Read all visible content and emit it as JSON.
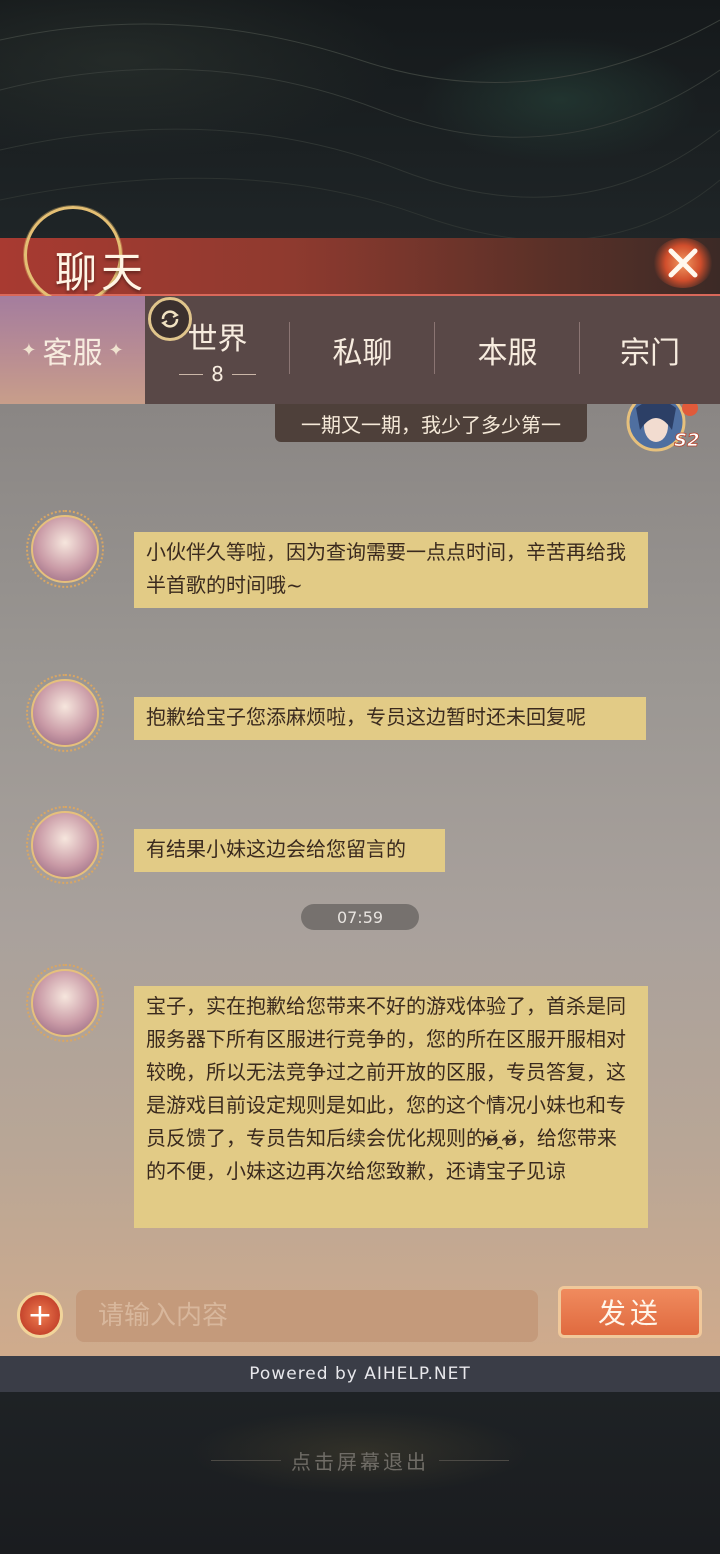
{
  "header": {
    "title": "聊天",
    "close_icon": "close-icon"
  },
  "tabs": [
    {
      "label": "客服",
      "active": true
    },
    {
      "label": "世界",
      "count": "8"
    },
    {
      "label": "私聊"
    },
    {
      "label": "本服"
    },
    {
      "label": "宗门"
    }
  ],
  "chat": {
    "system_message": "一期又一期，我少了多少第一",
    "user_badge": "S2",
    "messages": [
      {
        "text": "小伙伴久等啦，因为查询需要一点点时间，辛苦再给我半首歌的时间哦~"
      },
      {
        "text": "抱歉给宝子您添麻烦啦，专员这边暂时还未回复呢"
      },
      {
        "text": "有结果小妹这边会给您留言的"
      },
      {
        "text": "宝子，实在抱歉给您带来不好的游戏体验了，首杀是同服务器下所有区服进行竞争的，您的所在区服开服相对较晚，所以无法竞争过之前开放的区服，专员答复，这是游戏目前设定规则是如此，您的这个情况小妹也和专员反馈了，专员告知后续会优化规则的ʚ̴̶̷̆ ̯ʚ̴̶̷̆，给您带来的不便，小妹这边再次给您致歉，还请宝子见谅"
      }
    ],
    "timestamp": "07:59"
  },
  "input": {
    "placeholder": "请输入内容",
    "value": "",
    "send_label": "发送",
    "add_label": "+"
  },
  "footer": {
    "powered_by": "Powered by AIHELP.NET",
    "exit_hint": "点击屏幕退出"
  },
  "colors": {
    "bubble": "#e2cb86",
    "title_bar": "#a83a31",
    "send_button": "#e06a3f",
    "tab_active": "#a47d9e"
  }
}
